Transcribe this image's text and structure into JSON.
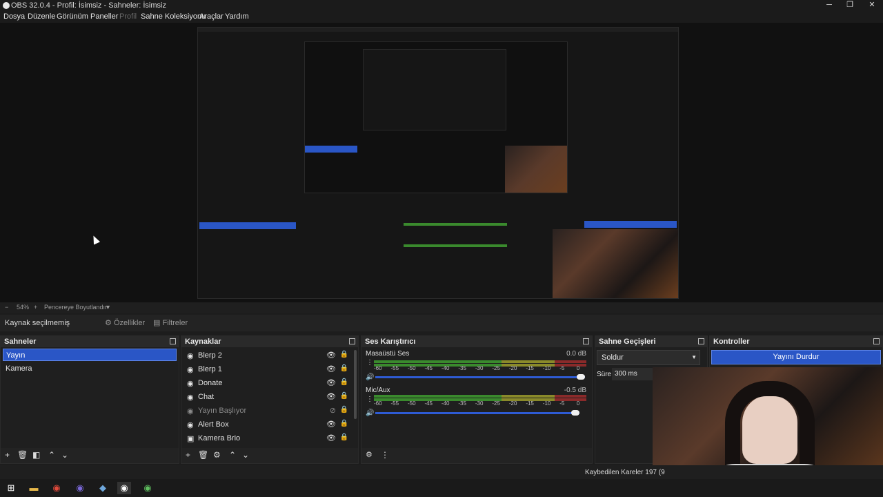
{
  "window": {
    "title": "OBS 32.0.4 - Profil: İsimsiz - Sahneler: İsimsiz",
    "controls": {
      "minimize": "─",
      "restore": "❐",
      "close": "✕"
    }
  },
  "menu": [
    "Dosya",
    "Düzenle",
    "Görünüm",
    "Paneller",
    "Profil",
    "Sahne Koleksiyonu",
    "Araçlar",
    "Yardım"
  ],
  "zoom": {
    "minus": "−",
    "value": "54%",
    "plus": "+",
    "mode": "Pencereye Boyutlandır"
  },
  "source_toolbar": {
    "label": "Kaynak seçilmemiş",
    "properties": "Özellikler",
    "filters": "Filtreler"
  },
  "scenes": {
    "title": "Sahneler",
    "items": [
      "Yayın",
      "Kamera"
    ],
    "selected": 0
  },
  "sources": {
    "title": "Kaynaklar",
    "items": [
      {
        "name": "Blerp 2",
        "icon": "chrome-icon",
        "visible": true
      },
      {
        "name": "Blerp 1",
        "icon": "chrome-icon",
        "visible": true
      },
      {
        "name": "Donate",
        "icon": "chrome-icon",
        "visible": true
      },
      {
        "name": "Chat",
        "icon": "chrome-icon",
        "visible": true
      },
      {
        "name": "Yayın Başlıyor",
        "icon": "chrome-icon",
        "visible": false
      },
      {
        "name": "Alert Box",
        "icon": "chrome-icon",
        "visible": true
      },
      {
        "name": "Kamera Brio",
        "icon": "camera-icon",
        "visible": true
      }
    ]
  },
  "mixer": {
    "title": "Ses Karıştırıcı",
    "ticks": [
      "-60",
      "-55",
      "-50",
      "-45",
      "-40",
      "-35",
      "-30",
      "-25",
      "-20",
      "-15",
      "-10",
      "-5",
      "0"
    ],
    "channels": [
      {
        "name": "Masaüstü Ses",
        "db": "0.0 dB",
        "volume": 1.0
      },
      {
        "name": "Mic/Aux",
        "db": "-0.5 dB",
        "volume": 0.97
      }
    ]
  },
  "transitions": {
    "title": "Sahne Geçişleri",
    "selected": "Soldur",
    "duration_label": "Süre",
    "duration_value": "300 ms"
  },
  "controls": {
    "title": "Kontroller",
    "stop_stream": "Yayını Durdur"
  },
  "status": {
    "dropped_frames": "Kaybedilen Kareler 197 (9"
  },
  "colors": {
    "accent": "#2a56c6",
    "meter_green": "#3a8a2d",
    "meter_yellow": "#8a8a2a",
    "meter_red": "#8a2a2a"
  }
}
